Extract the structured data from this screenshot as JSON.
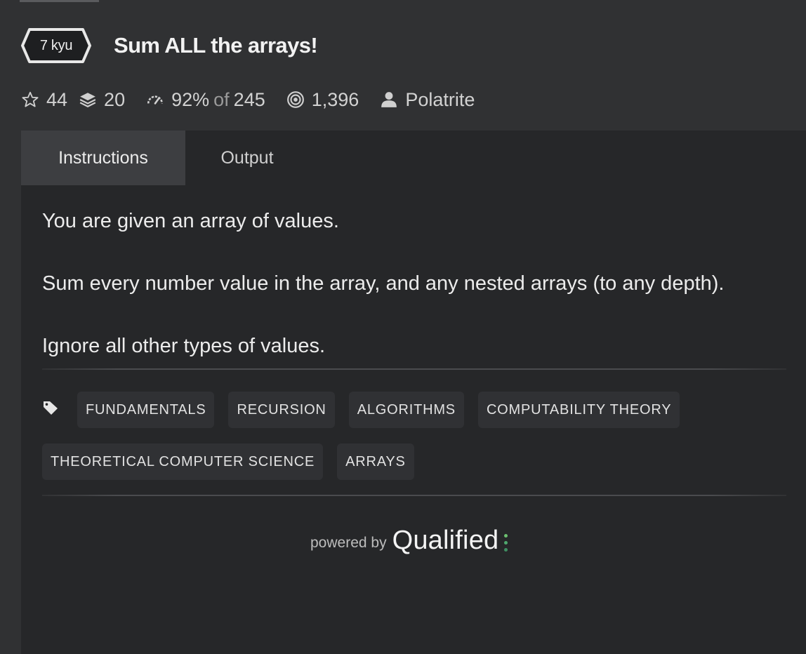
{
  "kata": {
    "rank": "7 kyu",
    "title": "Sum ALL the arrays!"
  },
  "stats": {
    "stars": "44",
    "collections": "20",
    "satisfaction_percent": "92%",
    "satisfaction_of": "of",
    "satisfaction_votes": "245",
    "completions": "1,396",
    "author": "Polatrite"
  },
  "tabs": [
    {
      "label": "Instructions",
      "active": true
    },
    {
      "label": "Output",
      "active": false
    }
  ],
  "description": [
    "You are given an array of values.",
    "Sum every number value in the array, and any nested arrays (to any depth).",
    "Ignore all other types of values."
  ],
  "tags": [
    "FUNDAMENTALS",
    "RECURSION",
    "ALGORITHMS",
    "COMPUTABILITY THEORY",
    "THEORETICAL COMPUTER SCIENCE",
    "ARRAYS"
  ],
  "footer": {
    "powered_by": "powered by",
    "brand": "Qualified"
  },
  "icons": {
    "stars": "star-outline-icon",
    "collections": "layers-icon",
    "satisfaction": "gauge-icon",
    "completions": "target-icon",
    "author": "user-icon",
    "tags": "tag-icon"
  },
  "colors": {
    "background": "#303133",
    "panel": "#262729",
    "active_tab": "#3d3e41",
    "tag_bg": "#303134",
    "brand_dot_top": "#6cc070",
    "brand_dot_mid": "#4fa86e",
    "brand_dot_bottom": "#3f8f62"
  }
}
